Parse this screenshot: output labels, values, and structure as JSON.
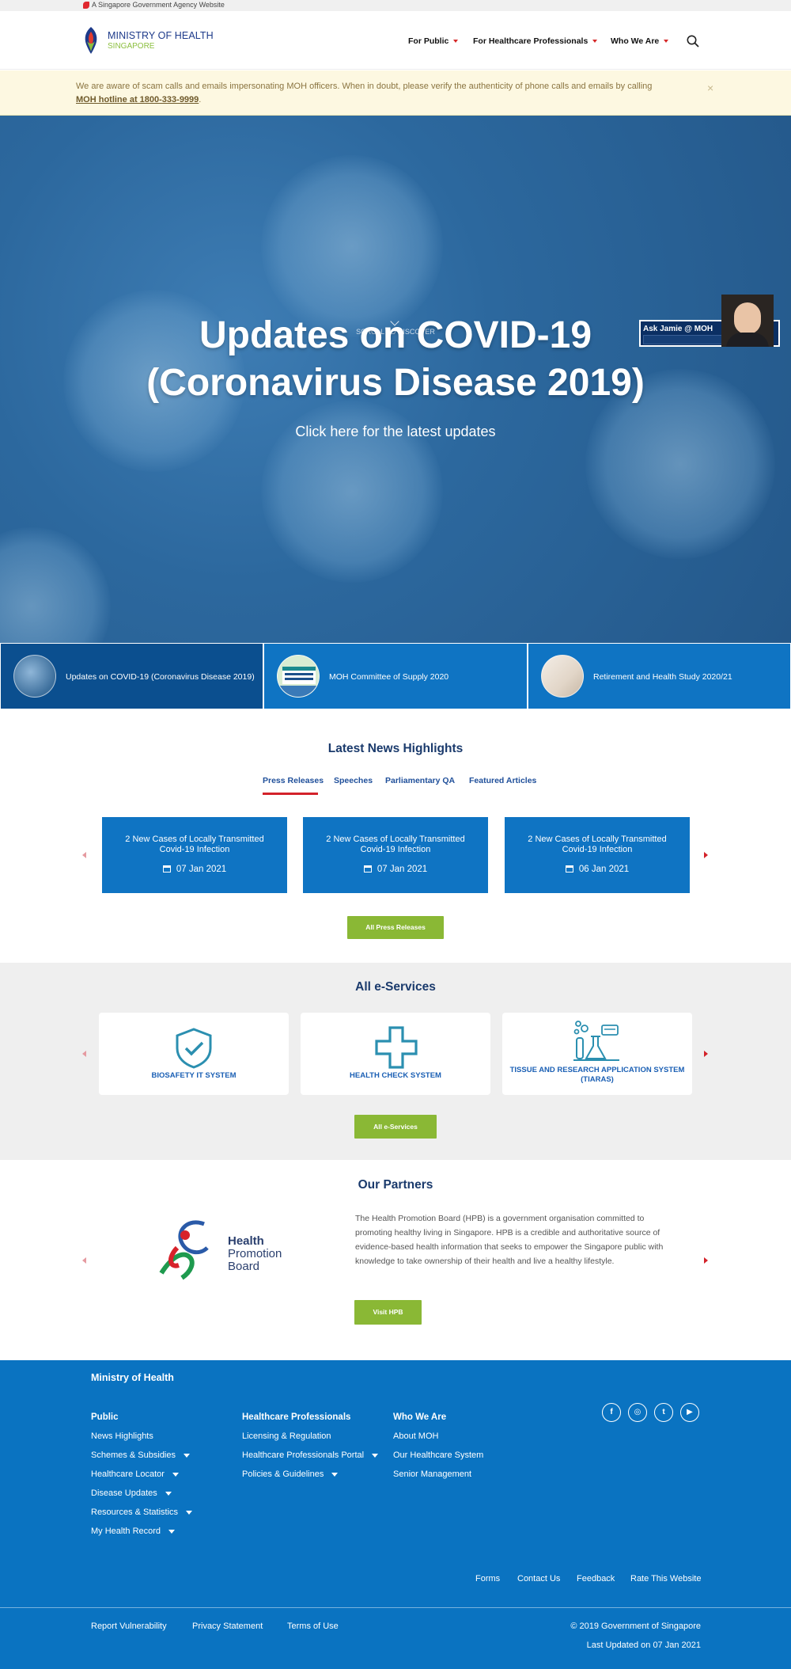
{
  "gov_bar": {
    "text": "A Singapore Government Agency Website"
  },
  "header": {
    "logo_title": "MINISTRY OF HEALTH",
    "logo_subtitle": "SINGAPORE",
    "nav": [
      {
        "label": "For Public"
      },
      {
        "label": "For Healthcare Professionals"
      },
      {
        "label": "Who We Are"
      }
    ],
    "search_icon": "search-icon"
  },
  "alert": {
    "text": "We are aware of scam calls and emails impersonating MOH officers. When in doubt, please verify the authenticity of phone calls and emails by calling",
    "link": "MOH hotline at 1800-333-9999",
    "tail": ".",
    "close": "×"
  },
  "hero": {
    "title_line1": "Updates on COVID-19",
    "title_line2": "(Coronavirus Disease 2019)",
    "subtitle": "Click here for the latest updates",
    "scroll_hint": "SCROLL TO DISCOVER"
  },
  "chatbot": {
    "label": "Ask Jamie @ MOH"
  },
  "feature_tiles": [
    {
      "label": "Updates on COVID-19 (Coronavirus Disease 2019)",
      "bg": "#0b4f8f"
    },
    {
      "label": "MOH Committee of Supply 2020",
      "bg": "#0f74c3"
    },
    {
      "label": "Retirement and Health Study 2020/21",
      "bg": "#0f74c3"
    }
  ],
  "news": {
    "title": "Latest News Highlights",
    "tabs": [
      "Press Releases",
      "Speeches",
      "Parliamentary QA",
      "Featured Articles"
    ],
    "cards": [
      {
        "title": "2 New Cases of Locally Transmitted Covid-19 Infection",
        "date": "07 Jan 2021"
      },
      {
        "title": "2 New Cases of Locally Transmitted Covid-19 Infection",
        "date": "07 Jan 2021"
      },
      {
        "title": "2 New Cases of Locally Transmitted Covid-19 Infection",
        "date": "06 Jan 2021"
      }
    ],
    "button": "All Press Releases"
  },
  "eservices": {
    "title": "All e-Services",
    "cards": [
      {
        "label": "BIOSAFETY IT SYSTEM",
        "icon": "shield-check-icon"
      },
      {
        "label": "HEALTH CHECK SYSTEM",
        "icon": "medical-cross-icon"
      },
      {
        "label": "TISSUE AND RESEARCH APPLICATION SYSTEM (TIARAS)",
        "icon": "lab-flask-icon"
      }
    ],
    "button": "All e-Services"
  },
  "partners": {
    "title": "Our Partners",
    "logo_line1": "Health",
    "logo_line2": "Promotion",
    "logo_line3": "Board",
    "description": "The Health Promotion Board (HPB) is a government organisation committed to promoting healthy living in Singapore. HPB is a credible and authoritative source of evidence-based health information that seeks to empower the Singapore public with knowledge to take ownership of their health and live a healthy lifestyle.",
    "button": "Visit HPB"
  },
  "footer": {
    "org": "Ministry of Health",
    "columns": [
      {
        "heading": "Public",
        "items": [
          {
            "label": "News Highlights",
            "dropdown": false
          },
          {
            "label": "Schemes & Subsidies",
            "dropdown": true
          },
          {
            "label": "Healthcare Locator",
            "dropdown": true
          },
          {
            "label": "Disease Updates",
            "dropdown": true
          },
          {
            "label": "Resources & Statistics",
            "dropdown": true
          },
          {
            "label": "My Health Record",
            "dropdown": true
          }
        ]
      },
      {
        "heading": "Healthcare Professionals",
        "items": [
          {
            "label": "Licensing & Regulation",
            "dropdown": false
          },
          {
            "label": "Healthcare Professionals Portal",
            "dropdown": true
          },
          {
            "label": "Policies & Guidelines",
            "dropdown": true
          }
        ]
      },
      {
        "heading": "Who We Are",
        "items": [
          {
            "label": "About MOH",
            "dropdown": false
          },
          {
            "label": "Our Healthcare System",
            "dropdown": false
          },
          {
            "label": "Senior Management",
            "dropdown": false
          }
        ]
      }
    ],
    "social": [
      {
        "glyph": "f",
        "icon": "facebook-icon"
      },
      {
        "glyph": "◎",
        "icon": "instagram-icon"
      },
      {
        "glyph": "t",
        "icon": "twitter-icon"
      },
      {
        "glyph": "▶",
        "icon": "youtube-icon"
      }
    ],
    "links": [
      "Forms",
      "Contact Us",
      "Feedback",
      "Rate This Website"
    ],
    "bottom_links": [
      "Report Vulnerability",
      "Privacy Statement",
      "Terms of Use"
    ],
    "copyright": "© 2019 Government of Singapore",
    "last_updated": "Last Updated on 07 Jan 2021"
  },
  "colors": {
    "brand_blue": "#0f74c3",
    "footer_blue": "#0a73c1",
    "accent_red": "#d3222a",
    "button_green": "#8ab835",
    "alert_bg": "#fdf8e1"
  }
}
